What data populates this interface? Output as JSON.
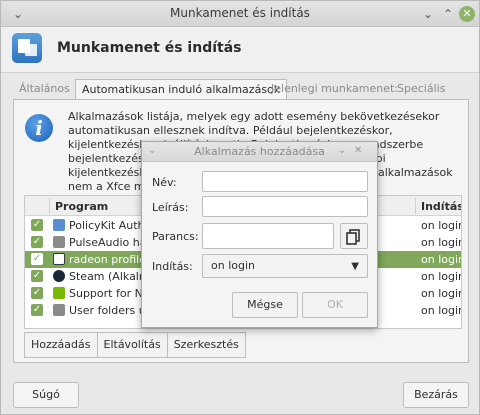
{
  "window": {
    "title": "Munkamenet és indítás"
  },
  "header": {
    "title": "Munkamenet és indítás",
    "icon": "session-app-icon"
  },
  "tabs": [
    "Általános",
    "Automatikusan induló alkalmazások",
    "Jelenlegi munkamenet:",
    "Speciális"
  ],
  "description": "Alkalmazások listája, melyek egy adott esemény bekövetkezésekor automatikusan ellesznek indítva. Például bejelentkezéskor, kijelentkezéskor, leállításkor stb. Bejelentkezéskor, a rendszerbe bejelentkezéskor elindítandó alkalmazások és a legutóbbi kijelentkezéskor futó alkalmazások. A dőlt betűvel jelölt alkalmazások nem a Xfce munkamenethez tartoznak, de igény esetén engedélyezhetők.",
  "list": {
    "headers": {
      "program": "Program",
      "start": "Indítás"
    },
    "rows": [
      {
        "name": "PolicyKit Authentication Agent",
        "start": "on login",
        "icon_color": "#5a8fcf"
      },
      {
        "name": "PulseAudio hangrendszer",
        "start": "on login",
        "icon_color": "#6a6a6a"
      },
      {
        "name": "radeon profile",
        "start": "on login",
        "icon_color": "#ffffff",
        "selected": true
      },
      {
        "name": "Steam (Alkalmazás)",
        "start": "on login",
        "icon_color": "#1b2838"
      },
      {
        "name": "Support for NVIDIA Prime",
        "start": "on login",
        "icon_color": "#76b900"
      },
      {
        "name": "User folders update",
        "start": "on login",
        "icon_color": "#6a6a6a"
      }
    ]
  },
  "group_buttons": [
    "Hozzáadás",
    "Eltávolítás",
    "Szerkesztés"
  ],
  "bottom": {
    "help": "Súgó",
    "close": "Bezárás"
  },
  "dialog": {
    "title": "Alkalmazás hozzáadása",
    "name_label": "Név:",
    "desc_label": "Leírás:",
    "cmd_label": "Parancs:",
    "trigger_label": "Indítás:",
    "trigger_value": "on login",
    "cancel": "Mégse",
    "ok": "OK"
  }
}
